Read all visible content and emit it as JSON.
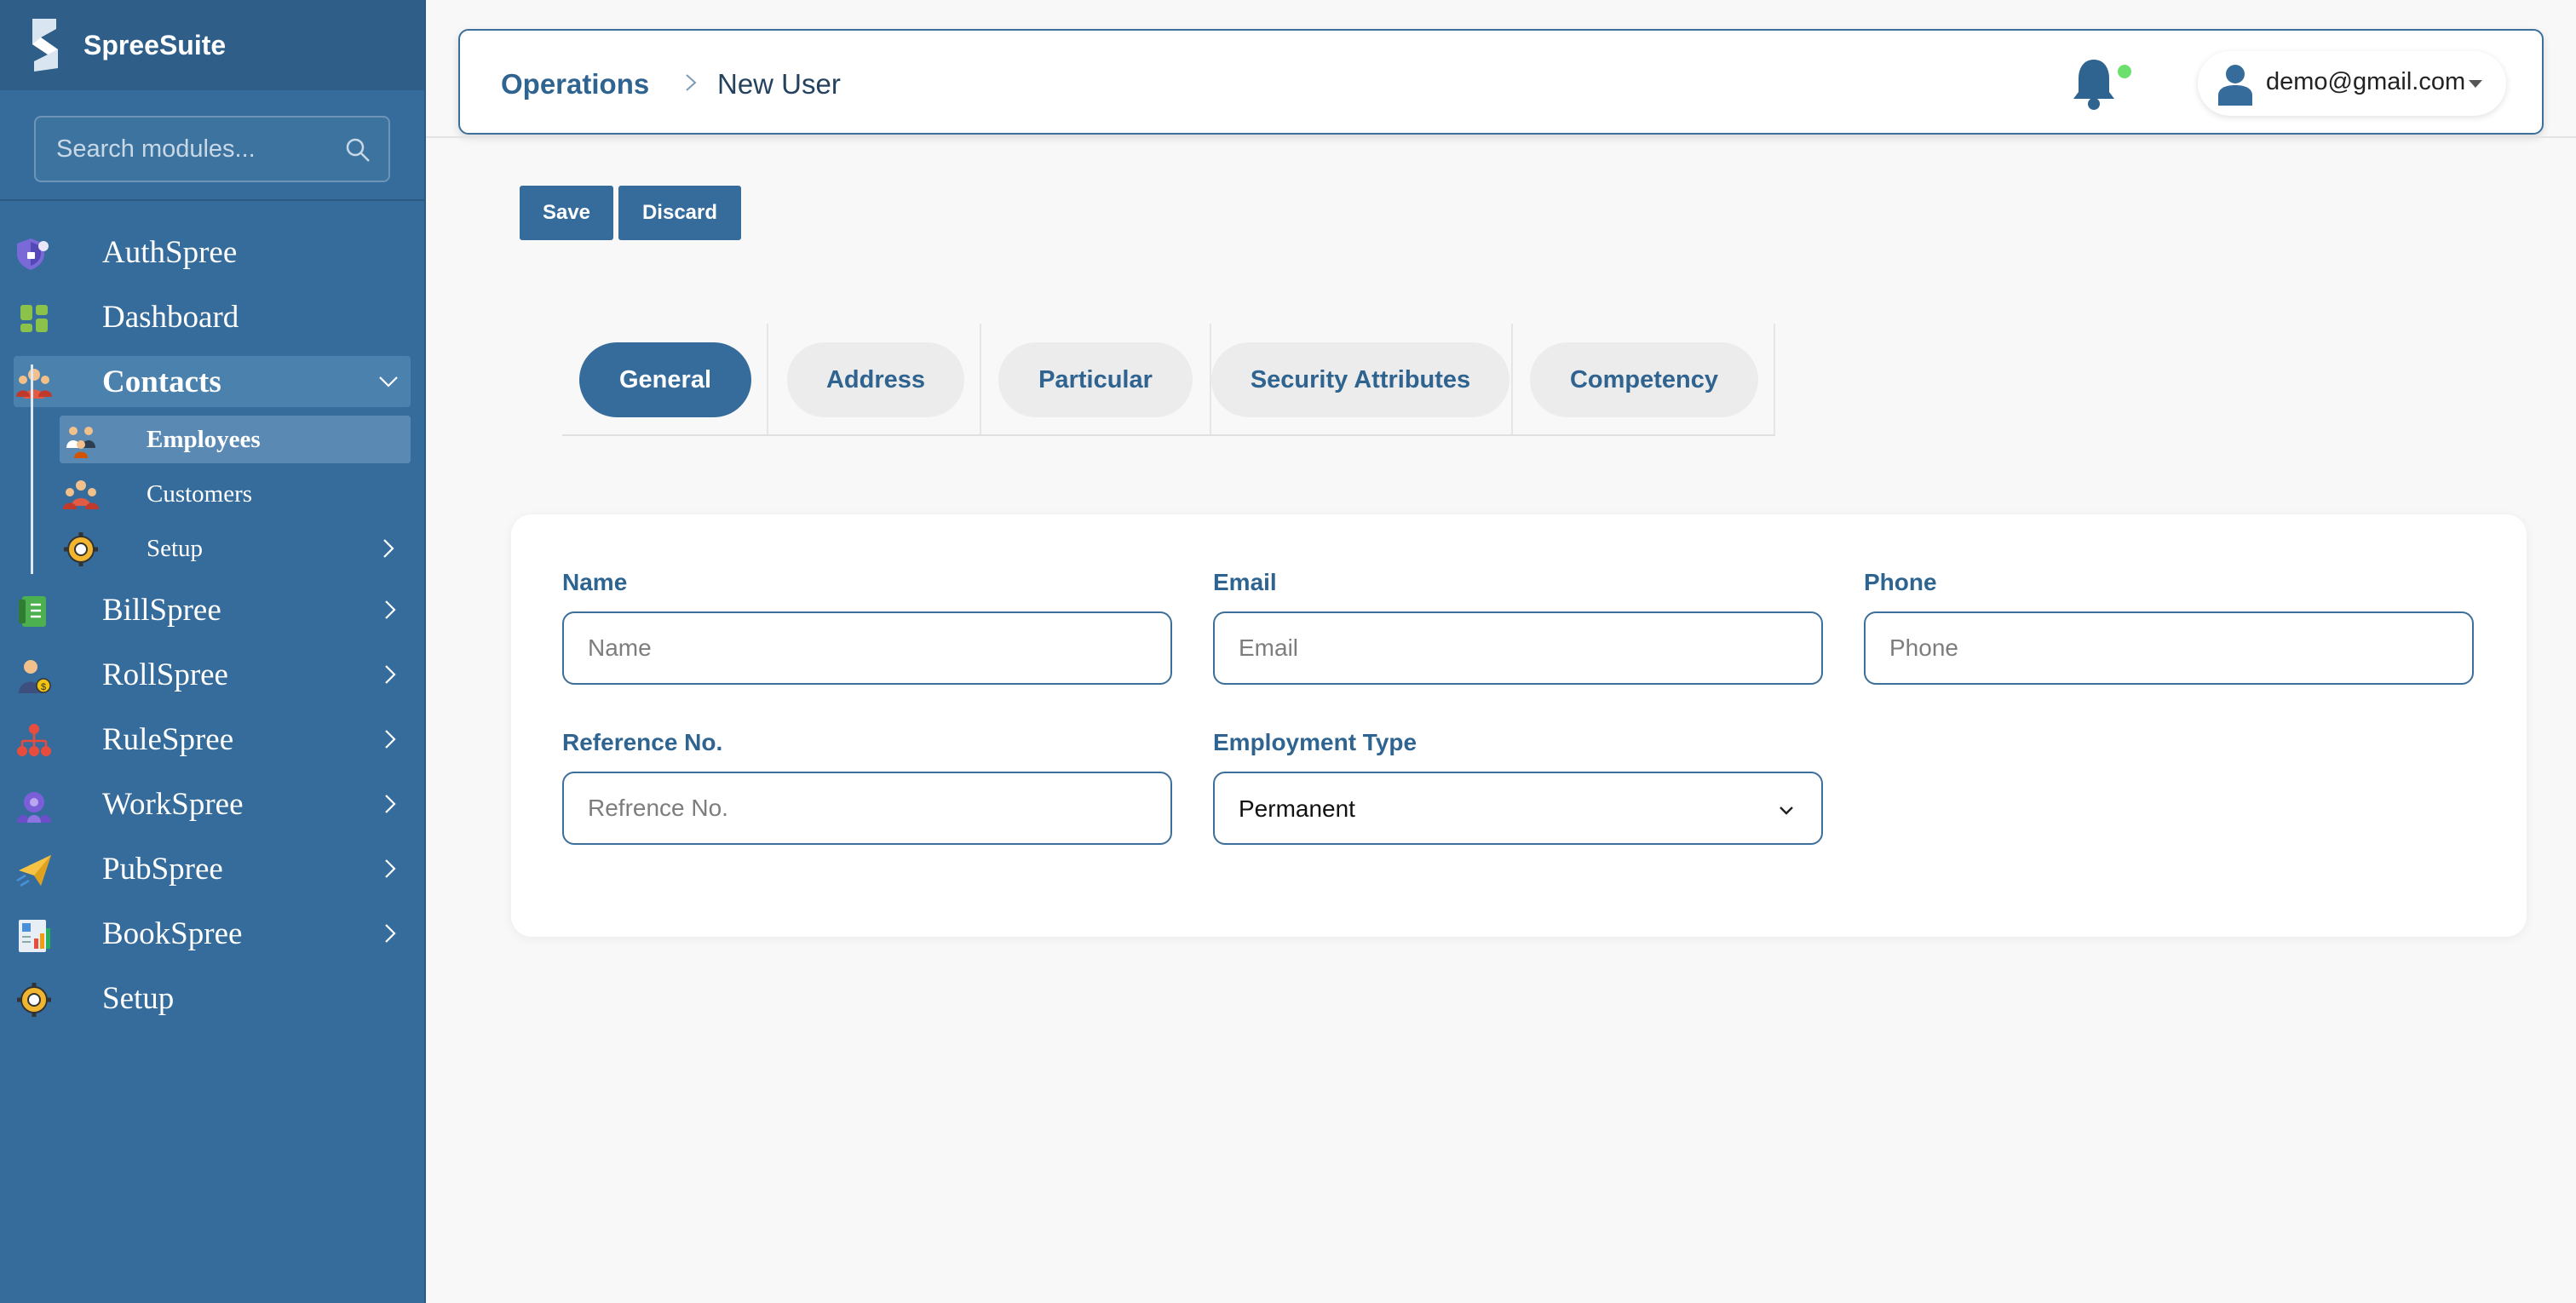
{
  "brand": {
    "name": "SpreeSuite"
  },
  "search": {
    "placeholder": "Search modules..."
  },
  "sidebar": {
    "items": [
      {
        "label": "AuthSpree"
      },
      {
        "label": "Dashboard"
      },
      {
        "label": "Contacts"
      },
      {
        "label": "BillSpree"
      },
      {
        "label": "RollSpree"
      },
      {
        "label": "RuleSpree"
      },
      {
        "label": "WorkSpree"
      },
      {
        "label": "PubSpree"
      },
      {
        "label": "BookSpree"
      },
      {
        "label": "Setup"
      }
    ],
    "contacts_children": [
      {
        "label": "Employees"
      },
      {
        "label": "Customers"
      },
      {
        "label": "Setup"
      }
    ]
  },
  "header": {
    "breadcrumb_root": "Operations",
    "breadcrumb_current": "New User",
    "user_email": "demo@gmail.com"
  },
  "actions": {
    "save_label": "Save",
    "discard_label": "Discard"
  },
  "tabs": [
    {
      "label": "General"
    },
    {
      "label": "Address"
    },
    {
      "label": "Particular"
    },
    {
      "label": "Security Attributes"
    },
    {
      "label": "Competency"
    }
  ],
  "form": {
    "name": {
      "label": "Name",
      "placeholder": "Name",
      "value": ""
    },
    "email": {
      "label": "Email",
      "placeholder": "Email",
      "value": ""
    },
    "phone": {
      "label": "Phone",
      "placeholder": "Phone",
      "value": ""
    },
    "reference": {
      "label": "Reference No.",
      "placeholder": "Refrence No.",
      "value": ""
    },
    "employment_type": {
      "label": "Employment Type",
      "value": "Permanent"
    }
  },
  "colors": {
    "sidebar_bg": "#356c9b",
    "accent": "#356c9b",
    "active_tab": "#356c9b",
    "notification_dot": "#6ce06c"
  }
}
